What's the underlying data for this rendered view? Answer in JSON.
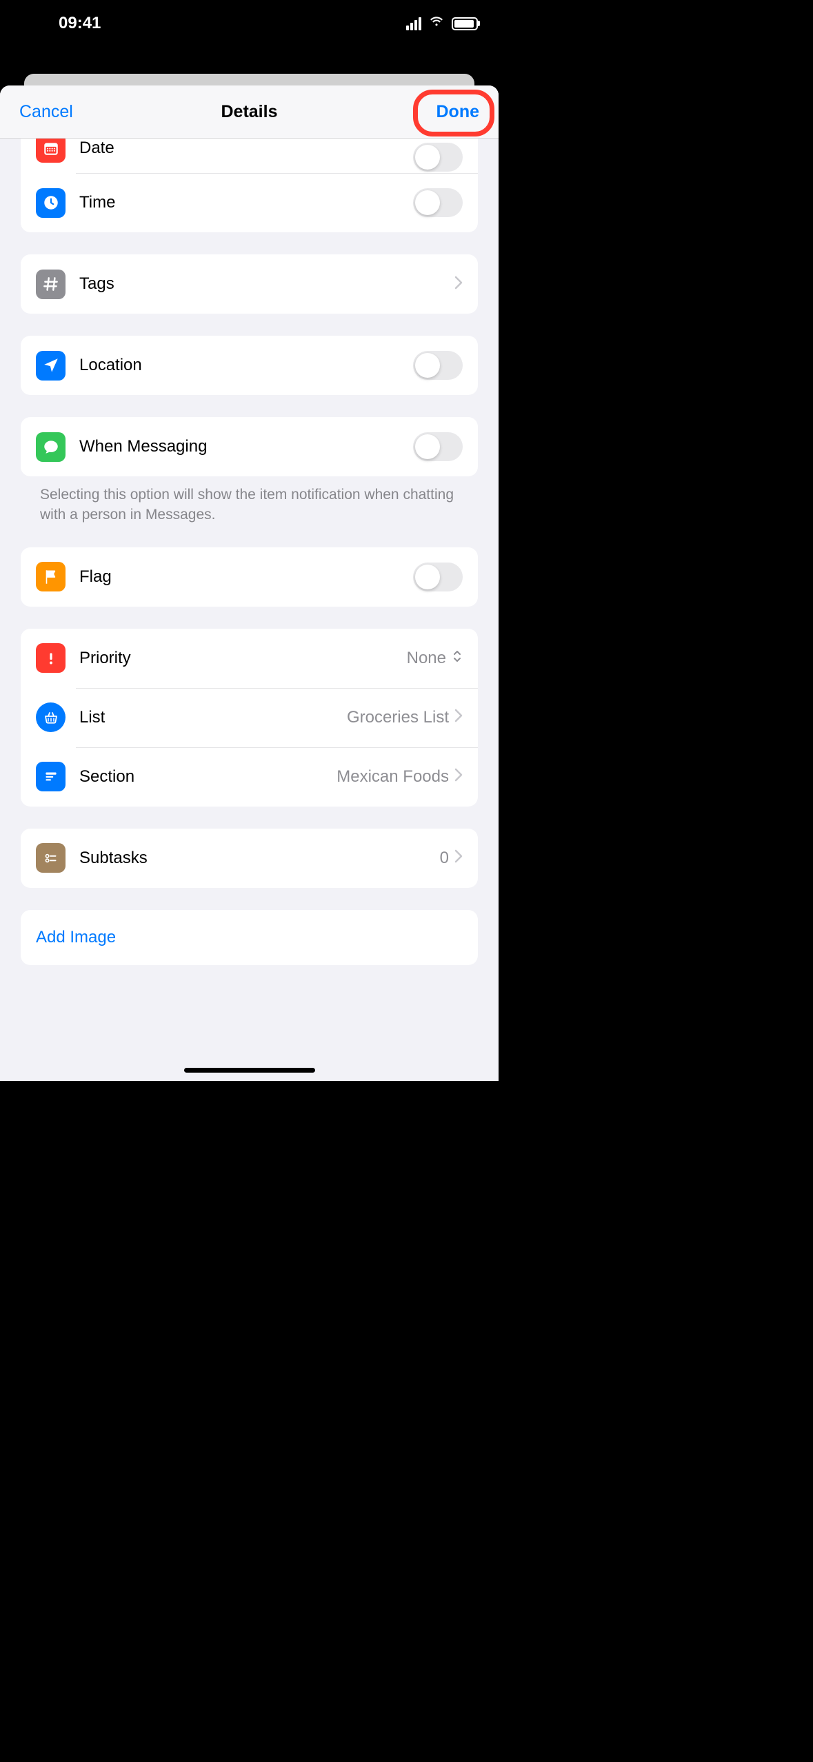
{
  "status": {
    "time": "09:41"
  },
  "nav": {
    "cancel": "Cancel",
    "title": "Details",
    "done": "Done"
  },
  "rows": {
    "date": "Date",
    "time": "Time",
    "tags": "Tags",
    "location": "Location",
    "messaging": "When Messaging",
    "flag": "Flag",
    "priority": "Priority",
    "priority_value": "None",
    "list": "List",
    "list_value": "Groceries List",
    "section": "Section",
    "section_value": "Mexican Foods",
    "subtasks": "Subtasks",
    "subtasks_value": "0",
    "add_image": "Add Image"
  },
  "notes": {
    "messaging": "Selecting this option will show the item notification when chatting with a person in Messages."
  }
}
